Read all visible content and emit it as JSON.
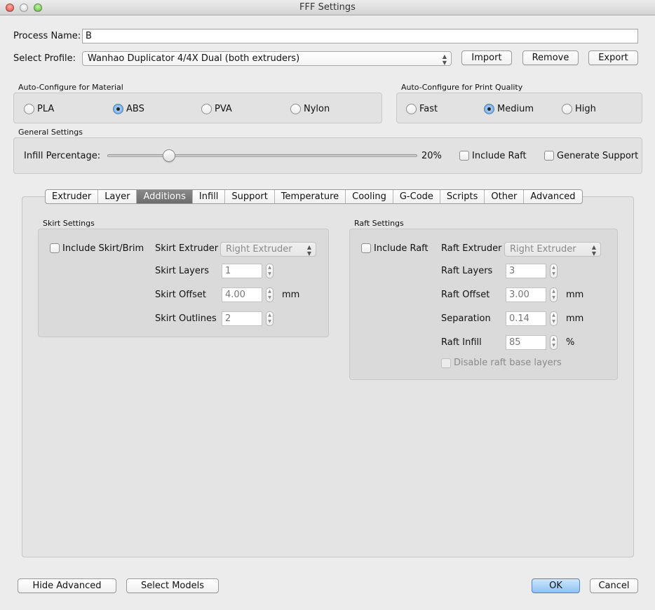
{
  "window": {
    "title": "FFF Settings"
  },
  "process": {
    "label": "Process Name:",
    "value": "B"
  },
  "profile": {
    "label": "Select Profile:",
    "selected": "Wanhao Duplicator 4/4X Dual (both extruders)",
    "import_label": "Import",
    "remove_label": "Remove",
    "export_label": "Export"
  },
  "material": {
    "title": "Auto-Configure for Material",
    "options": [
      "PLA",
      "ABS",
      "PVA",
      "Nylon"
    ],
    "selected": "ABS"
  },
  "quality": {
    "title": "Auto-Configure for Print Quality",
    "options": [
      "Fast",
      "Medium",
      "High"
    ],
    "selected": "Medium"
  },
  "general": {
    "title": "General Settings",
    "infill_label": "Infill Percentage:",
    "infill_value": 20,
    "infill_text": "20%",
    "include_raft_label": "Include Raft",
    "include_raft_checked": false,
    "generate_support_label": "Generate Support",
    "generate_support_checked": false
  },
  "tabs": {
    "items": [
      "Extruder",
      "Layer",
      "Additions",
      "Infill",
      "Support",
      "Temperature",
      "Cooling",
      "G-Code",
      "Scripts",
      "Other",
      "Advanced"
    ],
    "active": "Additions"
  },
  "skirt": {
    "title": "Skirt Settings",
    "include_label": "Include Skirt/Brim",
    "include_checked": false,
    "extruder_label": "Skirt Extruder",
    "extruder_value": "Right Extruder",
    "layers_label": "Skirt Layers",
    "layers_value": "1",
    "offset_label": "Skirt Offset",
    "offset_value": "4.00",
    "offset_unit": "mm",
    "outlines_label": "Skirt Outlines",
    "outlines_value": "2"
  },
  "raft": {
    "title": "Raft Settings",
    "include_label": "Include Raft",
    "include_checked": false,
    "extruder_label": "Raft Extruder",
    "extruder_value": "Right Extruder",
    "layers_label": "Raft Layers",
    "layers_value": "3",
    "offset_label": "Raft Offset",
    "offset_value": "3.00",
    "offset_unit": "mm",
    "separation_label": "Separation",
    "separation_value": "0.14",
    "separation_unit": "mm",
    "infill_label": "Raft Infill",
    "infill_value": "85",
    "infill_unit": "%",
    "disable_base_label": "Disable raft base layers",
    "disable_base_checked": false
  },
  "footer": {
    "hide_advanced_label": "Hide Advanced",
    "select_models_label": "Select Models",
    "ok_label": "OK",
    "cancel_label": "Cancel"
  }
}
